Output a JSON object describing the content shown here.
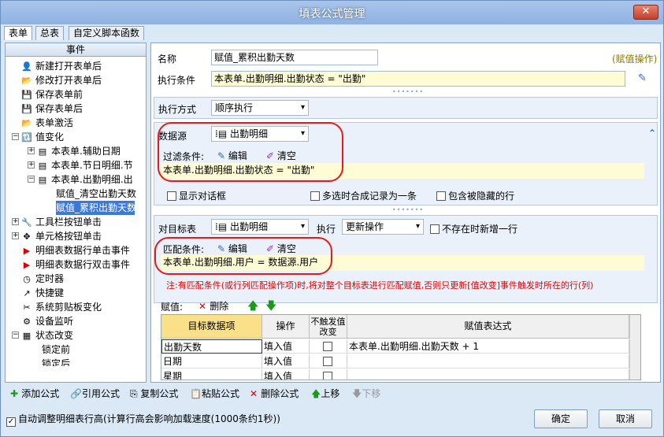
{
  "window": {
    "title": "填表公式管理",
    "close": "✕"
  },
  "tabs": [
    "表单",
    "总表",
    "自定义脚本函数"
  ],
  "left": {
    "header": "事件",
    "items": [
      {
        "label": "新建打开表单后",
        "icon": "👤"
      },
      {
        "label": "修改打开表单后",
        "icon": "📂"
      },
      {
        "label": "保存表单前",
        "icon": "💾"
      },
      {
        "label": "保存表单后",
        "icon": "💾"
      },
      {
        "label": "表单激活",
        "icon": "📂"
      },
      {
        "label": "值变化",
        "icon": "🔃"
      },
      {
        "label": "本表单.辅助日期",
        "icon": "▤"
      },
      {
        "label": "本表单.节日明细.节",
        "icon": "▤"
      },
      {
        "label": "本表单.出勤明细.出",
        "icon": "▤"
      },
      {
        "label": "赋值_清空出勤天数",
        "icon": ""
      },
      {
        "label": "赋值_累积出勤天数",
        "icon": ""
      },
      {
        "label": "工具栏按钮单击",
        "icon": "🔧"
      },
      {
        "label": "单元格按钮单击",
        "icon": "✥"
      },
      {
        "label": "明细表数据行单击事件",
        "icon": "▶"
      },
      {
        "label": "明细表数据行双击事件",
        "icon": "▶"
      },
      {
        "label": "定时器",
        "icon": "◷"
      },
      {
        "label": "快捷键",
        "icon": "↗"
      },
      {
        "label": "系统剪贴板变化",
        "icon": "✂"
      },
      {
        "label": "设备监听",
        "icon": "⚙"
      },
      {
        "label": "状态改变",
        "icon": "▦"
      },
      {
        "label": "锁定前",
        "icon": ""
      },
      {
        "label": "锁定后",
        "icon": ""
      }
    ]
  },
  "form": {
    "name_label": "名称",
    "name_value": "赋值_累积出勤天数",
    "assign_op": "(赋值操作)",
    "cond_label": "执行条件",
    "cond_value": "本表单.出勤明细.出勤状态 = \"出勤\"",
    "exec_mode_label": "执行方式",
    "exec_mode_value": "顺序执行",
    "datasource_label": "数据源",
    "datasource_value": "出勤明细",
    "filter_label": "过滤条件:",
    "edit": "编辑",
    "clear": "清空",
    "filter_value": "本表单.出勤明细.出勤状态 = \"出勤\"",
    "opt_show_dialog": "显示对话框",
    "opt_multi_merge": "多选时合成记录为一条",
    "opt_include_hidden": "包含被隐藏的行",
    "target_label": "对目标表",
    "target_value": "出勤明细",
    "exec_label": "执行",
    "exec_value": "更新操作",
    "opt_add_new": "不存在时新增一行",
    "match_label": "匹配条件:",
    "match_value": "本表单.出勤明细.用户 = 数据源.用户",
    "note": "注:有匹配条件(或行列匹配操作项)时,将对整个目标表进行匹配赋值,否则只更新[值改变]事件触发时所在的行(列)",
    "assign_label": "赋值:",
    "delete": "删除",
    "grid_headers": [
      "目标数据项",
      "操作",
      "不触发值改变",
      "赋值表达式"
    ],
    "rows": [
      {
        "item": "出勤天数",
        "op": "填入值",
        "expr": "本表单.出勤明细.出勤天数 + 1"
      },
      {
        "item": "日期",
        "op": "填入值",
        "expr": ""
      },
      {
        "item": "星期",
        "op": "填入值",
        "expr": ""
      }
    ]
  },
  "bottom": {
    "add": "添加公式",
    "ref": "引用公式",
    "copy": "复制公式",
    "paste": "粘贴公式",
    "del": "删除公式",
    "up": "上移",
    "down": "下移",
    "auto_adjust": "自动调整明细表行高(计算行高会影响加载速度(1000条约1秒))",
    "ok": "确定",
    "cancel": "取消"
  },
  "colors": {
    "selected": "#3b78d8",
    "accent_red": "#e21b1b",
    "yellow": "#fdfcd5"
  }
}
